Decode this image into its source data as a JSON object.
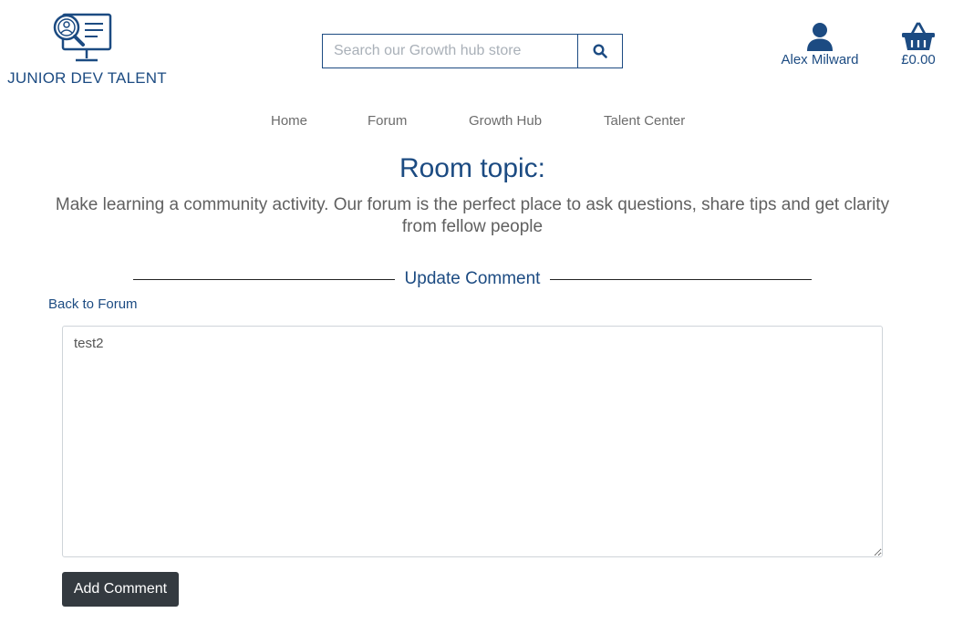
{
  "header": {
    "logo_text": "JUNIOR DEV TALENT",
    "search": {
      "placeholder": "Search our Growth hub store",
      "value": ""
    },
    "account_label": "Alex Milward",
    "basket_total": "£0.00"
  },
  "nav": {
    "items": [
      {
        "label": "Home"
      },
      {
        "label": "Forum"
      },
      {
        "label": "Growth Hub"
      },
      {
        "label": "Talent Center"
      }
    ]
  },
  "main": {
    "room_title": "Room topic:",
    "room_description": "Make learning a community activity. Our forum is the perfect place to ask questions, share tips and get clarity from fellow people",
    "section_heading": "Update Comment",
    "back_link": "Back to Forum",
    "comment_value": "test2",
    "submit_label": "Add Comment"
  },
  "colors": {
    "brand_blue": "#1c4b82",
    "button_dark": "#343a40"
  },
  "icons": {
    "logo": "talent-search-monitor-icon",
    "search": "search-icon",
    "account": "user-icon",
    "basket": "shopping-basket-icon"
  }
}
